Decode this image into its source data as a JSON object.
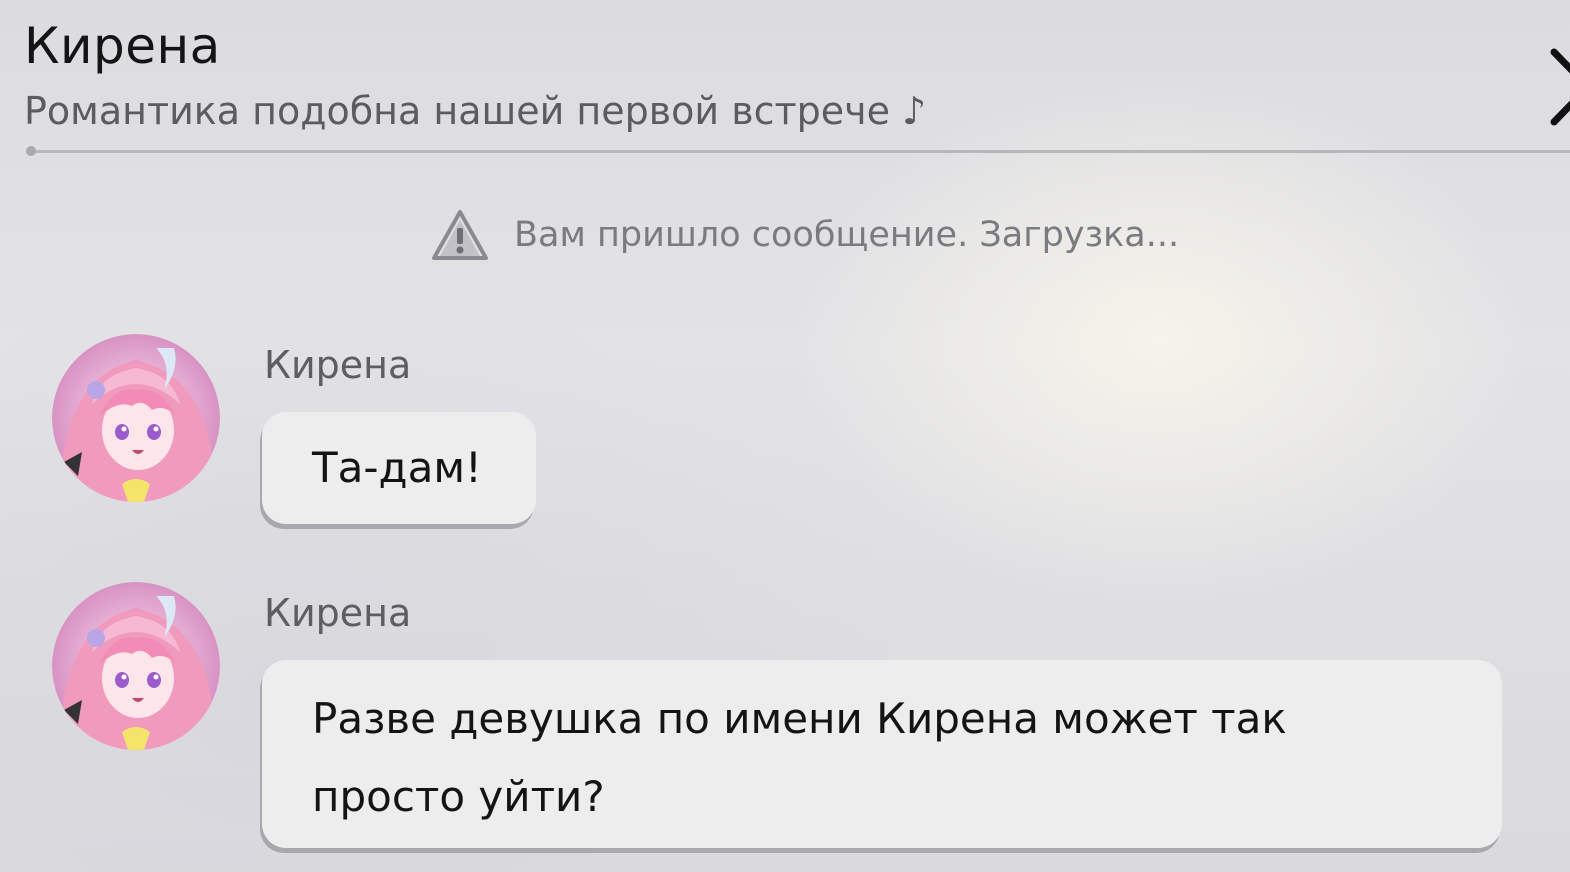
{
  "header": {
    "title": "Кирена",
    "subtitle": "Романтика подобна нашей первой встрече ♪"
  },
  "system_notice": {
    "icon": "warning-icon",
    "text": "Вам пришло сообщение. Загрузка..."
  },
  "messages": [
    {
      "sender": "Кирена",
      "text": "Та-дам!",
      "avatar": "character-avatar"
    },
    {
      "sender": "Кирена",
      "text": "Разве девушка по имени Кирена может так просто уйти?",
      "avatar": "character-avatar"
    }
  ],
  "colors": {
    "bubble": "#ededed",
    "title_text": "#141414",
    "secondary_text": "#5c5c60",
    "avatar_hair": "#f09bbd"
  }
}
